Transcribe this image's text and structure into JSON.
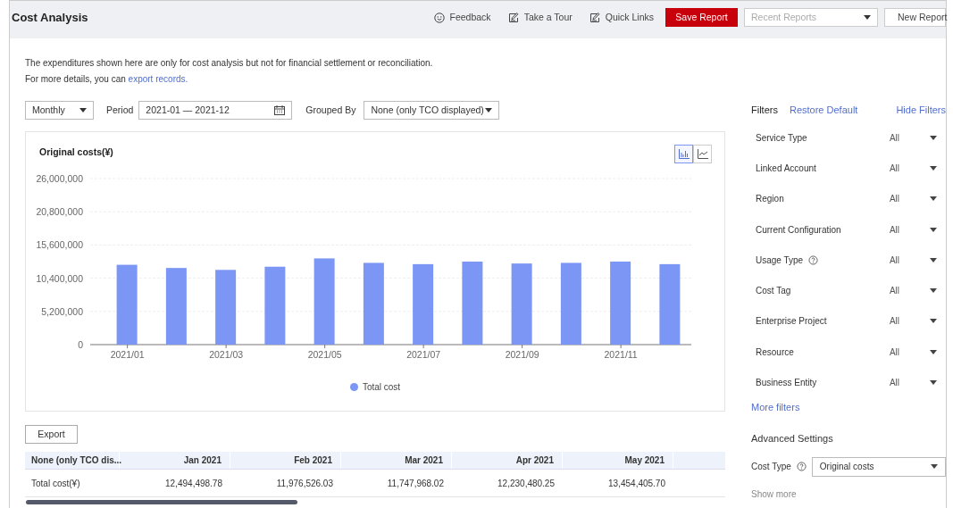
{
  "header": {
    "title": "Cost Analysis",
    "links": [
      {
        "kind": "feedback",
        "label": "Feedback"
      },
      {
        "kind": "tour",
        "label": "Take a Tour"
      },
      {
        "kind": "quick",
        "label": "Quick Links"
      }
    ],
    "save_button": "Save Report",
    "recent_reports": {
      "placeholder": "Recent Reports"
    },
    "new_button": "New Report"
  },
  "notice": [
    "The expenditures shown here are only for cost analysis but not for financial settlement or reconciliation.",
    {
      "text": "For more details, you can",
      "link": "export records."
    }
  ],
  "toolbar": {
    "granularity": "Monthly",
    "period_label": "Period",
    "period": "2021-01 — 2021-12",
    "grouped_label": "Grouped By",
    "grouped": "None (only TCO displayed)"
  },
  "chart_toggle": [
    {
      "kind": "bar",
      "selected": true
    },
    {
      "kind": "line",
      "selected": false
    }
  ],
  "chart_data": {
    "type": "bar",
    "title": "Original costs(¥)",
    "categories": [
      "2021/01",
      null,
      "2021/03",
      null,
      "2021/05",
      null,
      "2021/07",
      null,
      "2021/09",
      null,
      "2021/11",
      null
    ],
    "series": [
      {
        "name": "Total cost",
        "color": "#7b96f5",
        "values": [
          12500000,
          12000000,
          11700000,
          12200000,
          13500000,
          12800000,
          12600000,
          13000000,
          12700000,
          12800000,
          13000000,
          12600000
        ]
      }
    ],
    "ylim": [
      0,
      26000000
    ],
    "grid": true,
    "yticks": [
      {
        "value": 0,
        "label": "0"
      },
      {
        "value": 5200000,
        "label": "5,200,000"
      },
      {
        "value": 10400000,
        "label": "10,400,000"
      },
      {
        "value": 15600000,
        "label": "15,600,000"
      },
      {
        "value": 20800000,
        "label": "20,800,000"
      },
      {
        "value": 26000000,
        "label": "26,000,000"
      }
    ]
  },
  "export_button": "Export",
  "table": {
    "columns": [
      "None (only TCO dis...",
      "Jan 2021",
      "Feb 2021",
      "Mar 2021",
      "Apr 2021",
      "May 2021"
    ],
    "rows": [
      [
        "Total cost(¥)",
        "12,494,498.78",
        "11,976,526.03",
        "11,747,968.02",
        "12,230,480.25",
        "13,454,405.70"
      ]
    ]
  },
  "filters": {
    "title": "Filters",
    "restore": "Restore Default",
    "hide": "Hide Filters",
    "items": [
      {
        "label": "Service Type",
        "value": "All",
        "help": false
      },
      {
        "label": "Linked Account",
        "value": "All",
        "help": false
      },
      {
        "label": "Region",
        "value": "All",
        "help": false
      },
      {
        "label": "Current Configuration",
        "value": "All",
        "help": false
      },
      {
        "label": "Usage Type",
        "value": "All",
        "help": true
      },
      {
        "label": "Cost Tag",
        "value": "All",
        "help": false
      },
      {
        "label": "Enterprise Project",
        "value": "All",
        "help": false
      },
      {
        "label": "Resource",
        "value": "All",
        "help": false
      },
      {
        "label": "Business Entity",
        "value": "All",
        "help": false
      }
    ],
    "more": "More filters"
  },
  "advanced": {
    "title": "Advanced Settings",
    "cost_type_label": "Cost Type",
    "cost_type": "Original costs",
    "show_more": "Show more"
  }
}
